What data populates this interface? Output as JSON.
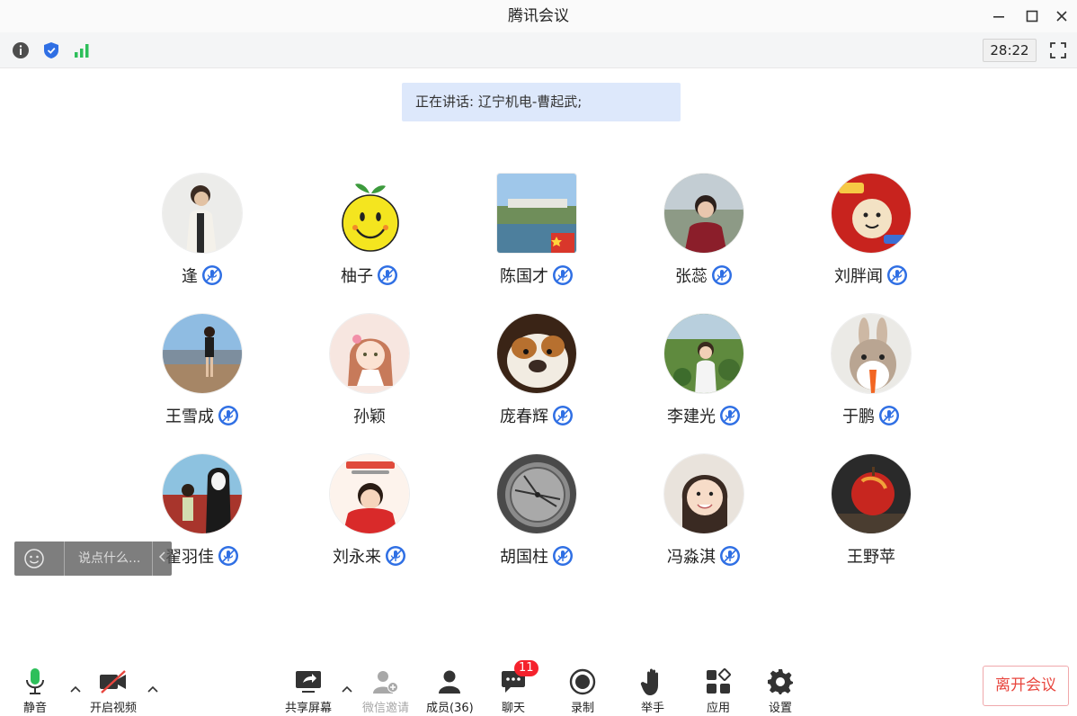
{
  "window": {
    "title": "腾讯会议"
  },
  "infobar": {
    "timer": "28:22"
  },
  "speaking": {
    "text": "正在讲话: 辽宁机电-曹起武;"
  },
  "participants": [
    {
      "name": "逢",
      "mic": true
    },
    {
      "name": "柚子",
      "mic": true
    },
    {
      "name": "陈国才",
      "mic": true
    },
    {
      "name": "张蕊",
      "mic": true
    },
    {
      "name": "刘胖闻",
      "mic": true
    },
    {
      "name": "王雪成",
      "mic": true
    },
    {
      "name": "孙颖",
      "mic": false
    },
    {
      "name": "庞春辉",
      "mic": true
    },
    {
      "name": "李建光",
      "mic": true
    },
    {
      "name": "于鹏",
      "mic": true
    },
    {
      "name": "翟羽佳",
      "mic": true
    },
    {
      "name": "刘永来",
      "mic": true
    },
    {
      "name": "胡国柱",
      "mic": true
    },
    {
      "name": "冯淼淇",
      "mic": true
    },
    {
      "name": "王野苹",
      "mic": false
    }
  ],
  "chat": {
    "placeholder": "说点什么..."
  },
  "toolbar": {
    "mute": "静音",
    "video": "开启视频",
    "share": "共享屏幕",
    "wechat_invite": "微信邀请",
    "members": "成员(36)",
    "chat": "聊天",
    "chat_badge": "11",
    "record": "录制",
    "raise_hand": "举手",
    "apps": "应用",
    "settings": "设置",
    "leave": "离开会议"
  },
  "colors": {
    "accent_blue": "#2f6fe4",
    "leave_red": "#e8463e",
    "mic_green": "#2dbf5a"
  }
}
